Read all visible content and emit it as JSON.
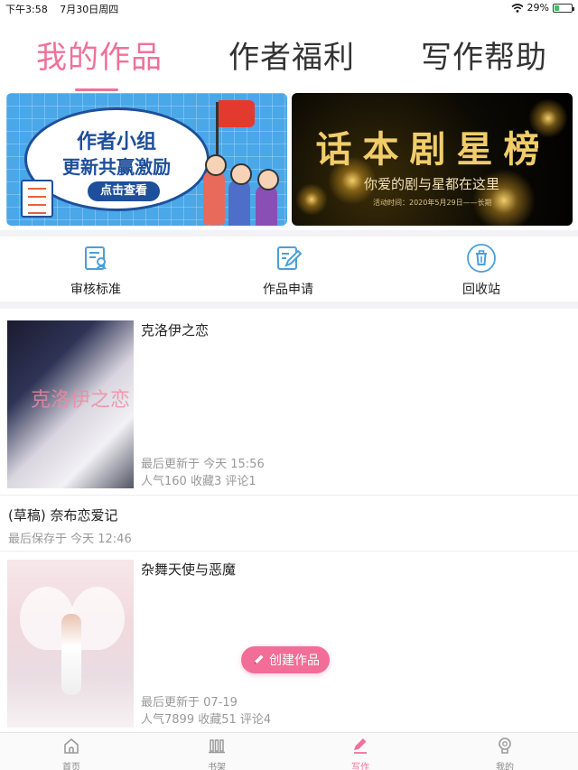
{
  "status_bar": {
    "time": "下午3:58",
    "date": "7月30日周四",
    "battery": "29%",
    "battery_level": 0.29,
    "wifi_icon": "wifi-icon",
    "battery_icon": "battery-charging-icon"
  },
  "tabs": [
    {
      "label": "我的作品",
      "active": true
    },
    {
      "label": "作者福利",
      "active": false
    },
    {
      "label": "写作帮助",
      "active": false
    }
  ],
  "banners": {
    "left": {
      "line1": "作者小组",
      "line2": "更新共赢激励",
      "cta": "点击查看"
    },
    "right": {
      "title": "话本剧星榜",
      "subtitle": "你爱的剧与星都在这里",
      "date": "活动时间：2020年5月29日——长期"
    }
  },
  "tools": [
    {
      "label": "审核标准",
      "icon": "review-criteria-icon"
    },
    {
      "label": "作品申请",
      "icon": "edit-application-icon"
    },
    {
      "label": "回收站",
      "icon": "trash-icon"
    }
  ],
  "works": [
    {
      "title": "克洛伊之恋",
      "cover_text": "克洛伊之恋",
      "updated": "最后更新于 今天 15:56",
      "stats": "人气160 收藏3 评论1"
    },
    {
      "title": "(草稿) 奈布恋爱记",
      "updated": "最后保存于 今天 12:46"
    },
    {
      "title": "杂舞天使与恶魔",
      "updated": "最后更新于 07-19",
      "stats": "人气7899 收藏51 评论4"
    }
  ],
  "create_button": {
    "label": "创建作品",
    "icon": "pencil-icon"
  },
  "bottom_nav": [
    {
      "label": "首页",
      "icon": "home-icon",
      "active": false
    },
    {
      "label": "书架",
      "icon": "bookshelf-icon",
      "active": false
    },
    {
      "label": "写作",
      "icon": "write-icon",
      "active": true
    },
    {
      "label": "我的",
      "icon": "profile-icon",
      "active": false
    }
  ],
  "colors": {
    "accent": "#f0719a",
    "button": "#f26d98",
    "icon_blue": "#4a9fd8",
    "muted_text": "#999999"
  }
}
